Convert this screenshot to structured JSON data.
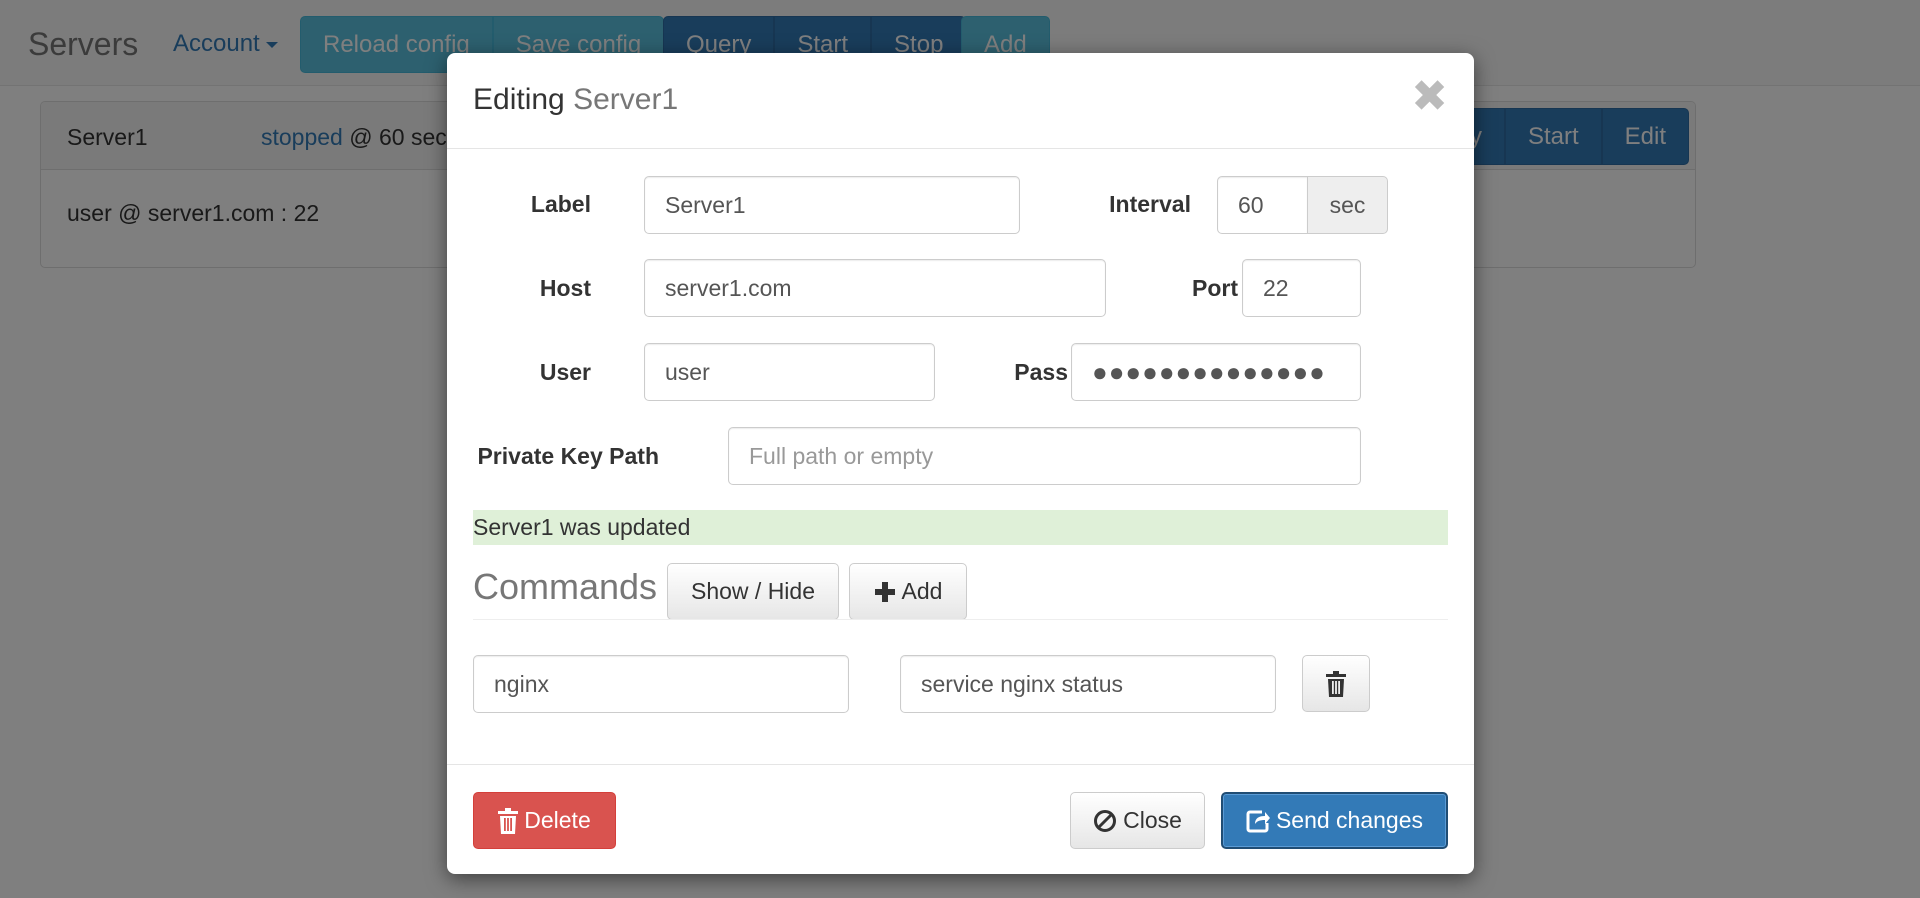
{
  "navbar": {
    "brand": "Servers",
    "account_label": "Account",
    "reload_label": "Reload config",
    "save_label": "Save config",
    "query_label": "Query",
    "start_label": "Start",
    "stop_label": "Stop",
    "add_label": "Add"
  },
  "server_panel": {
    "label": "Server1",
    "status_word": "stopped",
    "status_rest": "@ 60 sec",
    "query_label": "Query",
    "start_label": "Start",
    "edit_label": "Edit",
    "connection": "user @ server1.com : 22"
  },
  "modal": {
    "title_prefix": "Editing",
    "title_name": "Server1",
    "close_glyph": "✖",
    "fields": {
      "label_label": "Label",
      "label_value": "Server1",
      "interval_label": "Interval",
      "interval_value": "60",
      "interval_unit": "sec",
      "host_label": "Host",
      "host_value": "server1.com",
      "port_label": "Port",
      "port_value": "22",
      "user_label": "User",
      "user_value": "user",
      "pass_label": "Pass",
      "pass_value": "●●●●●●●●●●●●●●",
      "key_label": "Private Key Path",
      "key_placeholder": "Full path or empty"
    },
    "alert": "Server1 was updated",
    "commands": {
      "title": "Commands",
      "showhide_label": "Show / Hide",
      "add_label": "Add",
      "rows": [
        {
          "name": "nginx",
          "command": "service nginx status"
        }
      ]
    },
    "footer": {
      "delete_label": "Delete",
      "close_label": "Close",
      "send_label": "Send changes"
    }
  },
  "colors": {
    "primary": "#337ab7",
    "info": "#5bc0de",
    "danger": "#d9534f",
    "success_bg": "#dff0d8"
  }
}
